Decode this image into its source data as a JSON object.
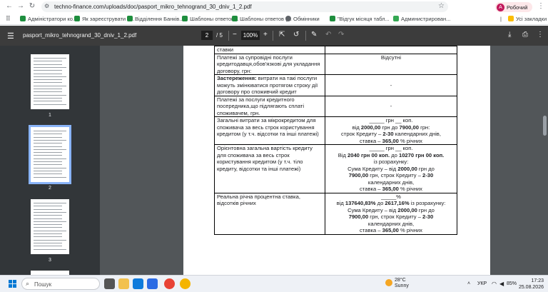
{
  "browser": {
    "url": "techno-finance.com/uploads/doc/pasport_mikro_tehnogrand_30_dniv_1_2.pdf",
    "profile_initial": "A",
    "profile_label": "Робочий",
    "bookmarks": [
      {
        "label": "Адміністратори ко...",
        "icon": "sheet-icon"
      },
      {
        "label": "Як зареєструвати с...",
        "icon": "sheet-icon"
      },
      {
        "label": "Відділення Банків...",
        "icon": "sheet-icon"
      },
      {
        "label": "Шаблоны ответов...",
        "icon": "sheet-icon"
      },
      {
        "label": "Шаблоны ответов (...",
        "icon": "sheet-icon"
      },
      {
        "label": "Обмінники",
        "icon": "globe-icon"
      },
      {
        "label": "\"Відгук місяця табл...",
        "icon": "sheet-icon"
      },
      {
        "label": "Администрирован...",
        "icon": "doc-icon"
      }
    ],
    "all_bookmarks_label": "Усі закладки"
  },
  "pdf_toolbar": {
    "filename": "pasport_mikro_tehnogrand_30_dniv_1_2.pdf",
    "page_current": "2",
    "page_total": "/ 5",
    "zoom": "100%"
  },
  "thumbnails": [
    {
      "label": "1"
    },
    {
      "label": "2"
    },
    {
      "label": "3"
    }
  ],
  "table": {
    "rows": [
      {
        "left": "ставки",
        "right": ""
      },
      {
        "left": "Платежі за супровідні послуги кредитодавця,обов'язкові для укладання договору, грн:",
        "right": "Відсутні"
      },
      {
        "left_bold": "Застереження:",
        "left": " витрати на такі послуги можуть змінюватися протягом строку дії договору про споживчий кредит",
        "right": "-"
      },
      {
        "left": "Платежі за послуги кредитного посередника,що підлягають сплаті споживачем, грн.",
        "right": "-"
      },
      {
        "left": "Загальні витрати за мікрокредитом для споживача за весь строк користування кредитом (у т.ч. відсотки та інші платежі)",
        "right_lines": [
          "_____ грн __ коп.",
          "від |2000,00| грн до |7900,00| грн:",
          "строк Кредиту – |2-30| календарних днів,",
          "ставка – |365,00| % річних"
        ]
      },
      {
        "left": "Орієнтовна загальна вартість кредиту для споживача за весь строк користування кредитом (у т.ч. тіло кредиту, відсотки та інші платежі)",
        "right_lines": [
          "_____ грн __ коп.",
          "Від |2040 грн 00 коп.| до |10270 грн 00 коп.|",
          "із розрахунку:",
          "Сума Кредиту – від |2000,00| грн до",
          "|7900,00| грн, строк Кредиту – |2-30|",
          "календарних днів,",
          "ставка – |365,00| % річних"
        ]
      },
      {
        "left": "Реальна річна процентна ставка, відсотків річних",
        "right_lines": [
          "_____%",
          "від |137640,83%| до  |2617,16%| із розрахунку:",
          "Сума Кредиту – від |2000,00| грн до",
          "|7900,00| грн, строк Кредиту – |2-30|",
          "календарних днів,",
          "ставка – |365,00| % річних"
        ]
      }
    ]
  },
  "taskbar": {
    "search_placeholder": "Пошук",
    "weather_temp": "28°C",
    "weather_desc": "Sunny",
    "lang": "УКР",
    "battery": "85%",
    "time": "17:23",
    "date": "25.08.2026"
  }
}
